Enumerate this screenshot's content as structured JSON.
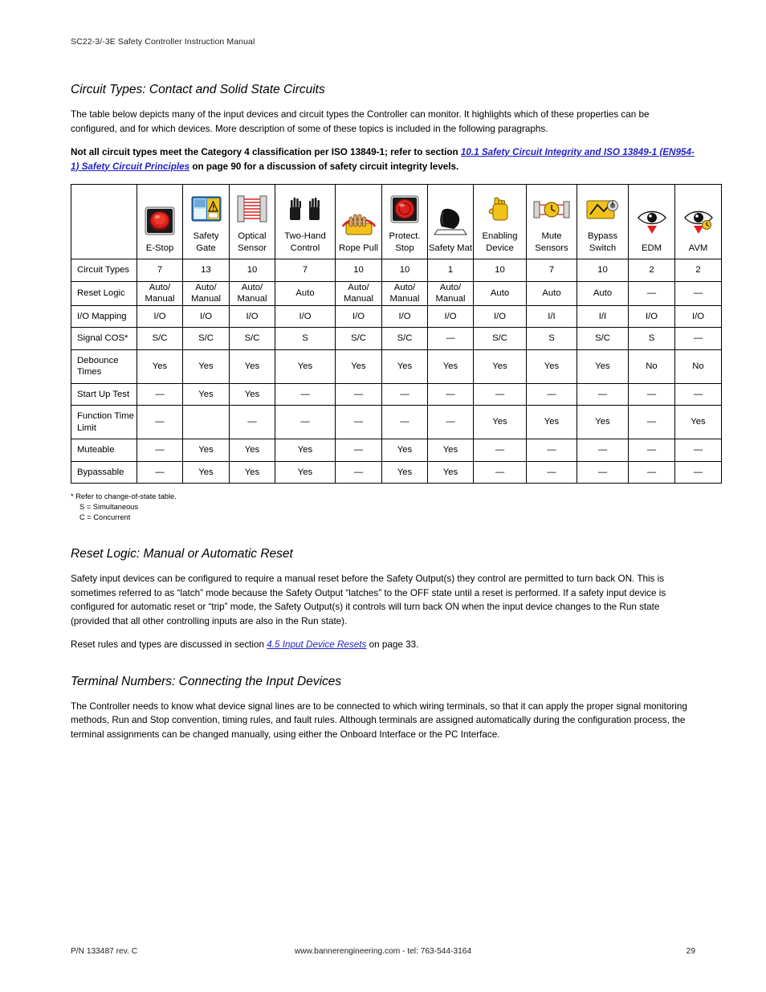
{
  "header": {
    "manual_title": "SC22-3/-3E Safety Controller Instruction Manual"
  },
  "sections": {
    "circuit_types": {
      "title": "Circuit Types: Contact and Solid State Circuits",
      "paragraph": "The table below depicts many of the input devices and circuit types the Controller can monitor. It highlights which of these properties can be configured, and for which devices. More description of some of these topics is included in the following paragraphs.",
      "note_part1": "Not all circuit types meet the Category 4 classification per ISO 13849-1; refer to section ",
      "note_link": "10.1 Safety Circuit Integrity and ISO 13849-1 (EN954-1) Safety Circuit Principles",
      "note_part2": " on page 90 for a discussion of safety circuit integrity levels."
    },
    "reset_logic": {
      "title": "Reset Logic: Manual or Automatic Reset",
      "paragraph1": "Safety input devices can be configured to require a manual reset before the Safety Output(s) they control are permitted to turn back ON. This is sometimes referred to as “latch” mode because the Safety Output “latches” to the OFF state until a reset is performed. If a safety input device is configured for automatic reset or “trip” mode, the Safety Output(s) it controls will turn back ON when the input device changes to the Run state (provided that all other controlling inputs are also in the Run state).",
      "paragraph2_part1": "Reset rules and types are discussed in section ",
      "paragraph2_link": "4.5 Input Device Resets",
      "paragraph2_part2": " on page 33."
    },
    "terminal_numbers": {
      "title": "Terminal Numbers: Connecting the Input Devices",
      "paragraph": "The Controller needs to know what device signal lines are to be connected to which wiring terminals, so that it can apply the proper signal monitoring methods, Run and Stop convention, timing rules, and fault rules. Although terminals are assigned automatically during the configuration process, the terminal assignments can be changed manually, using either the Onboard Interface or the PC Interface."
    }
  },
  "table": {
    "columns": [
      {
        "label": "E-Stop",
        "icon": "estop-icon"
      },
      {
        "label": "Safety Gate",
        "icon": "safety-gate-icon"
      },
      {
        "label": "Optical Sensor",
        "icon": "optical-sensor-icon"
      },
      {
        "label": "Two-Hand Control",
        "icon": "two-hand-control-icon"
      },
      {
        "label": "Rope Pull",
        "icon": "rope-pull-icon"
      },
      {
        "label": "Protect. Stop",
        "icon": "protective-stop-icon"
      },
      {
        "label": "Safety Mat",
        "icon": "safety-mat-icon"
      },
      {
        "label": "Enabling Device",
        "icon": "enabling-device-icon"
      },
      {
        "label": "Mute Sensors",
        "icon": "mute-sensors-icon"
      },
      {
        "label": "Bypass Switch",
        "icon": "bypass-switch-icon"
      },
      {
        "label": "EDM",
        "icon": "edm-eye-icon"
      },
      {
        "label": "AVM",
        "icon": "avm-eye-icon"
      }
    ],
    "rows": [
      {
        "label": "Circuit Types",
        "values": [
          "7",
          "13",
          "10",
          "7",
          "10",
          "10",
          "1",
          "10",
          "7",
          "10",
          "2",
          "2"
        ]
      },
      {
        "label": "Reset Logic",
        "values": [
          "Auto/ Manual",
          "Auto/ Manual",
          "Auto/ Manual",
          "Auto",
          "Auto/ Manual",
          "Auto/ Manual",
          "Auto/ Manual",
          "Auto",
          "Auto",
          "Auto",
          "—",
          "—"
        ]
      },
      {
        "label": "I/O Mapping",
        "values": [
          "I/O",
          "I/O",
          "I/O",
          "I/O",
          "I/O",
          "I/O",
          "I/O",
          "I/O",
          "I/I",
          "I/I",
          "I/O",
          "I/O"
        ]
      },
      {
        "label": "Signal COS*",
        "values": [
          "S/C",
          "S/C",
          "S/C",
          "S",
          "S/C",
          "S/C",
          "—",
          "S/C",
          "S",
          "S/C",
          "S",
          "—"
        ]
      },
      {
        "label": "Debounce Times",
        "values": [
          "Yes",
          "Yes",
          "Yes",
          "Yes",
          "Yes",
          "Yes",
          "Yes",
          "Yes",
          "Yes",
          "Yes",
          "No",
          "No"
        ]
      },
      {
        "label": "Start Up Test",
        "values": [
          "—",
          "Yes",
          "Yes",
          "—",
          "—",
          "—",
          "—",
          "—",
          "—",
          "—",
          "—",
          "—"
        ]
      },
      {
        "label": "Function Time Limit",
        "values": [
          "—",
          "",
          "—",
          "—",
          "—",
          "—",
          "—",
          "Yes",
          "Yes",
          "Yes",
          "—",
          "Yes"
        ]
      },
      {
        "label": "Muteable",
        "values": [
          "—",
          "Yes",
          "Yes",
          "Yes",
          "—",
          "Yes",
          "Yes",
          "—",
          "—",
          "—",
          "—",
          "—"
        ]
      },
      {
        "label": "Bypassable",
        "values": [
          "—",
          "Yes",
          "Yes",
          "Yes",
          "—",
          "Yes",
          "Yes",
          "—",
          "—",
          "—",
          "—",
          "—"
        ]
      }
    ],
    "footnotes": [
      "* Refer to change-of-state table.",
      "S = Simultaneous",
      "C = Concurrent"
    ]
  },
  "footer": {
    "part_number": "P/N 133487 rev. C",
    "center": "www.bannerengineering.com - tel: 763-544-3164",
    "page": "29"
  },
  "colors": {
    "link": "#2222cc",
    "estop_red": "#d81f1f",
    "yellow": "#f2c21a",
    "blue": "#2c6fb5"
  }
}
